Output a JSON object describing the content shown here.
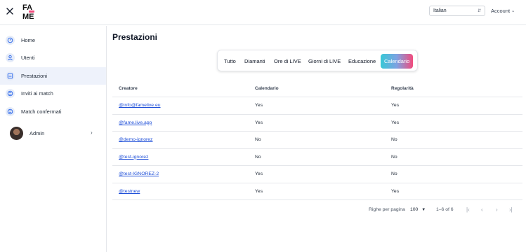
{
  "topbar": {
    "language": "Italian",
    "account_label": "Account"
  },
  "sidebar": {
    "items": [
      {
        "label": "Home"
      },
      {
        "label": "Utenti"
      },
      {
        "label": "Prestazioni"
      },
      {
        "label": "Inviti ai match"
      },
      {
        "label": "Match confermati"
      }
    ],
    "active_index": 2,
    "user": {
      "label": "Admin"
    }
  },
  "main": {
    "title": "Prestazioni",
    "tabs": [
      {
        "label": "Tutto"
      },
      {
        "label": "Diamanti"
      },
      {
        "label": "Ore di LIVE"
      },
      {
        "label": "Giorni di LIVE"
      },
      {
        "label": "Educazione"
      },
      {
        "label": "Calendario"
      }
    ],
    "active_tab": 5,
    "table": {
      "headers": [
        "Creatore",
        "Calendario",
        "Regolarità"
      ],
      "rows": [
        [
          "@info@famelive.eu",
          "Yes",
          "Yes"
        ],
        [
          "@fame.live.app",
          "Yes",
          "Yes"
        ],
        [
          "@demo-ignorez",
          "No",
          "No"
        ],
        [
          "@test-ignorez",
          "No",
          "No"
        ],
        [
          "@test-IGNOREZ-2",
          "Yes",
          "No"
        ],
        [
          "@testnew",
          "Yes",
          "Yes"
        ]
      ]
    },
    "pagination": {
      "rows_per_page_label": "Righe per pagina",
      "rows_per_page": "100",
      "range": "1–6 of 6"
    }
  },
  "colors": {
    "active_nav_bg": "#eef2fb",
    "link": "#1d4ed8",
    "tab_gradient_start": "#37c8d6",
    "tab_gradient_end": "#f24a7c"
  }
}
